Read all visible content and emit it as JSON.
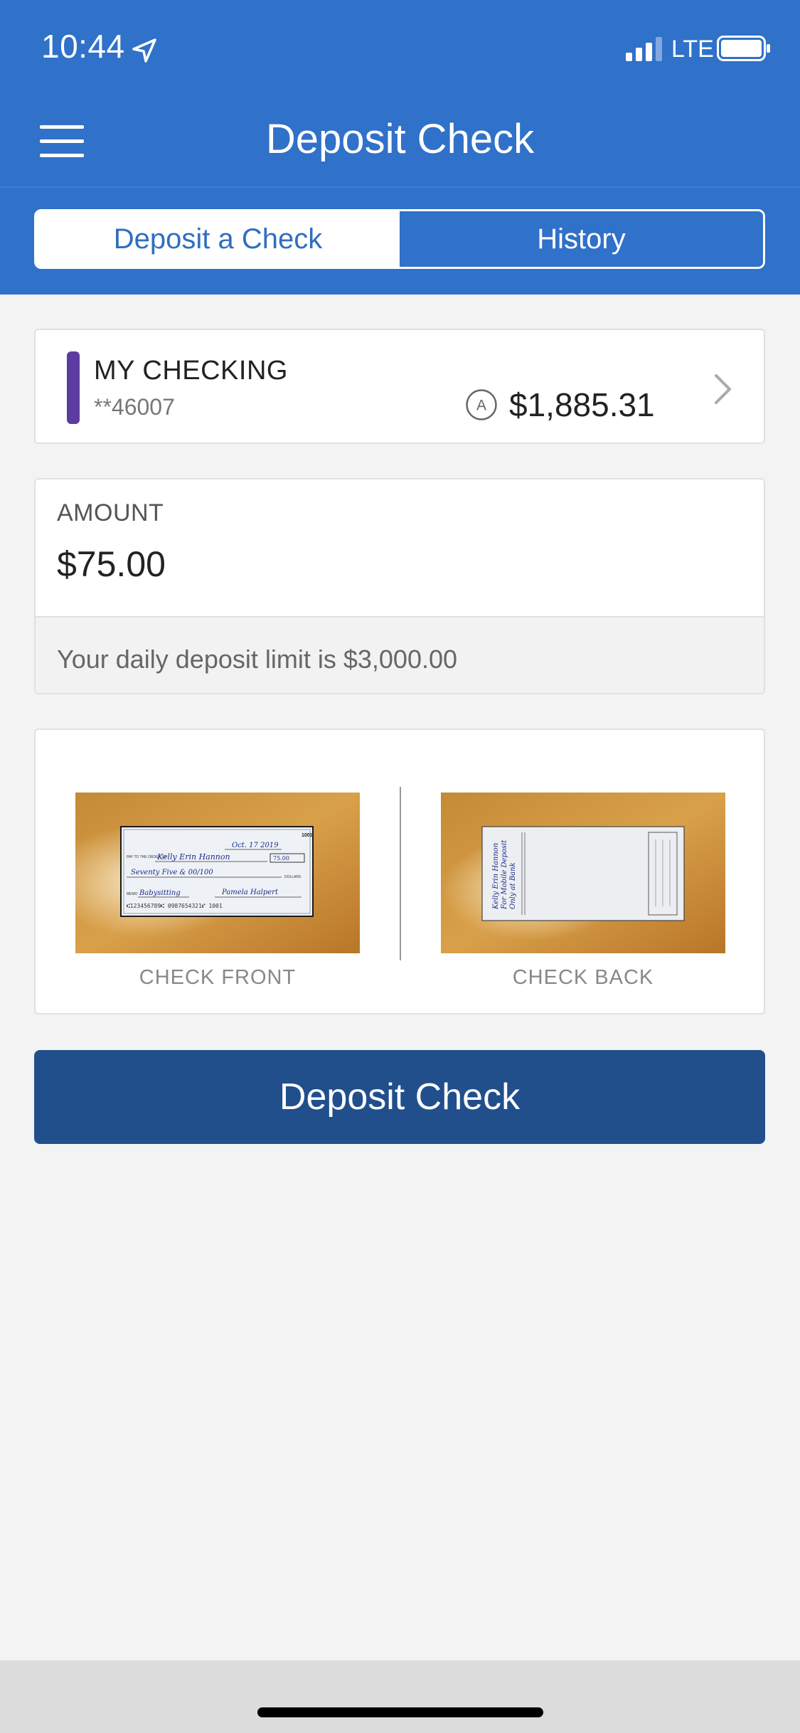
{
  "status_bar": {
    "time": "10:44",
    "network": "LTE",
    "icons": [
      "location-arrow-icon",
      "signal-icon",
      "battery-icon"
    ]
  },
  "nav": {
    "title": "Deposit Check",
    "menu_icon": "hamburger-menu-icon"
  },
  "tabs": [
    {
      "label": "Deposit a Check",
      "active": true
    },
    {
      "label": "History",
      "active": false
    }
  ],
  "account": {
    "name": "MY CHECKING",
    "number": "**46007",
    "available_icon_letter": "A",
    "balance": "$1,885.31",
    "accent_color": "#5b3ca0"
  },
  "amount": {
    "label": "AMOUNT",
    "value": "$75.00",
    "limit_text": "Your daily deposit limit is $3,000.00"
  },
  "check_images": {
    "front_label": "CHECK FRONT",
    "back_label": "CHECK BACK",
    "front": {
      "number": "1001",
      "date": "Oct. 17 2019",
      "pay_to_caption": "PAY TO THE ORDER OF",
      "payee": "Kelly Erin Hannon",
      "amount_box": "75.00",
      "amount_words": "Seventy Five & 00/100",
      "dollars_caption": "DOLLARS",
      "memo_caption": "MEMO",
      "memo": "Babysitting",
      "signature": "Pamela Halpert",
      "micr": "⑆123456789⑆ 0987654321⑈ 1001"
    },
    "back": {
      "endorsement_lines": [
        "Kelly Erin Hannon",
        "For Mobile Deposit",
        "Only at Bank"
      ]
    }
  },
  "actions": {
    "deposit_label": "Deposit Check"
  },
  "colors": {
    "header_blue": "#3071c9",
    "button_blue": "#204f8c",
    "background": "#f3f3f3"
  }
}
